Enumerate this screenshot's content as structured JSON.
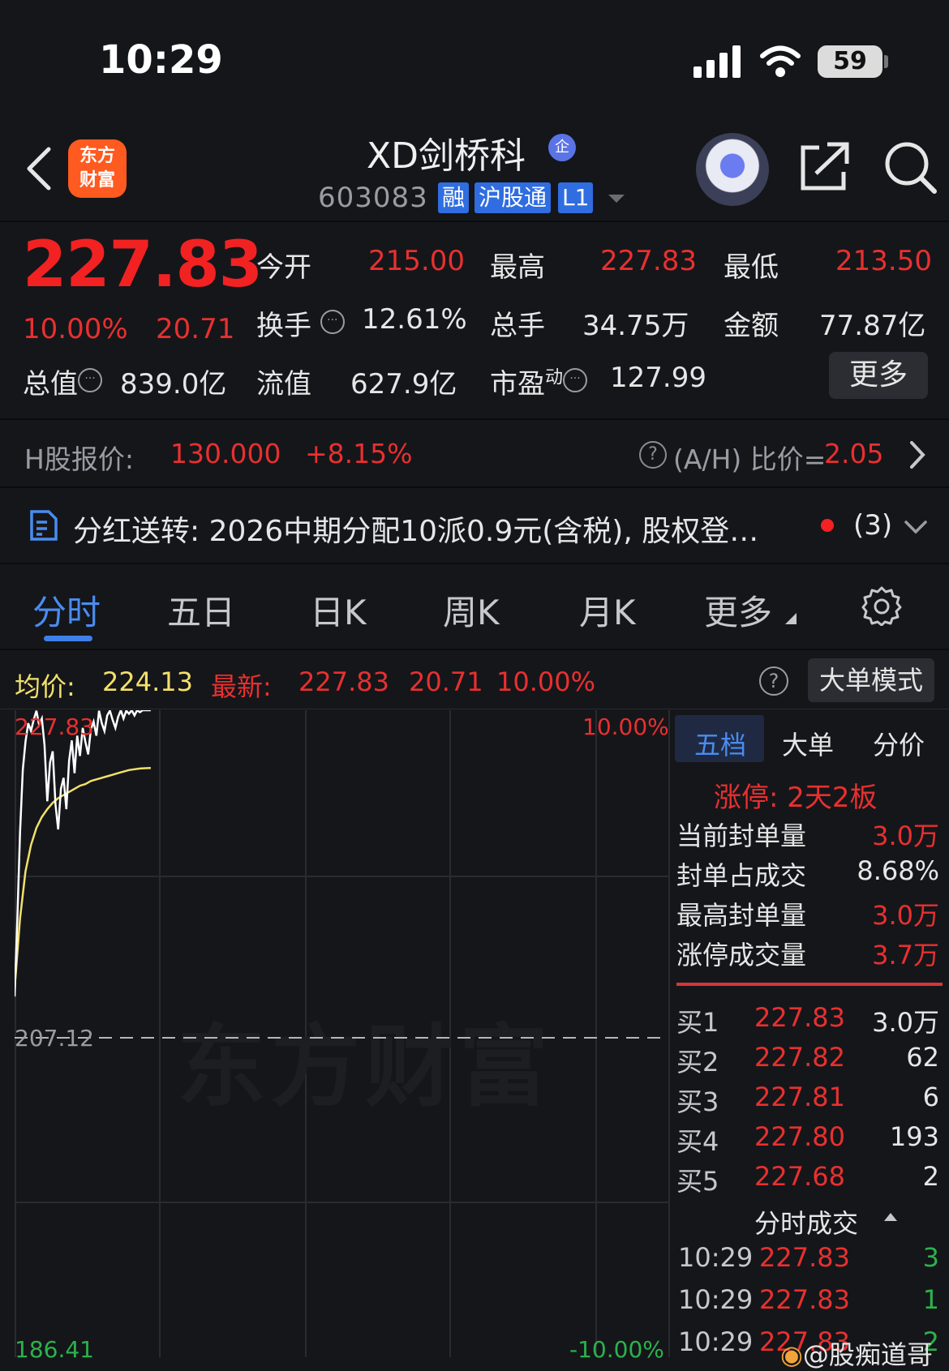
{
  "status_bar": {
    "time": "10:29",
    "battery": "59"
  },
  "header": {
    "logo_text": [
      "东方",
      "财富"
    ],
    "title": "XD剑桥科",
    "badge": "企",
    "code": "603083",
    "tags": [
      "融",
      "沪股通",
      "L1"
    ]
  },
  "quote": {
    "price": "227.83",
    "change_pct": "10.00%",
    "change": "20.71",
    "open_label": "今开",
    "open": "215.00",
    "high_label": "最高",
    "high": "227.83",
    "low_label": "最低",
    "low": "213.50",
    "turnover_label": "换手",
    "turnover": "12.61%",
    "volume_label": "总手",
    "volume": "34.75万",
    "amount_label": "金额",
    "amount": "77.87亿",
    "mktcap_label": "总值",
    "mktcap": "839.0亿",
    "float_label": "流值",
    "float": "627.9亿",
    "pe_label": "市盈",
    "pe_sup": "动",
    "pe": "127.99",
    "more": "更多"
  },
  "h_share": {
    "label": "H股报价:",
    "price": "130.000",
    "change": "+8.15%",
    "ratio_label": "(A/H) 比价=",
    "ratio": "2.05"
  },
  "dividend": {
    "text": "分红送转: 2026中期分配10派0.9元(含税), 股权登…",
    "count": "(3)"
  },
  "tabs": [
    "分时",
    "五日",
    "日K",
    "周K",
    "月K",
    "更多"
  ],
  "chart_header": {
    "avg_label": "均价:",
    "avg": "224.13",
    "latest_label": "最新:",
    "latest": "227.83",
    "latest_change": "20.71",
    "latest_pct": "10.00%",
    "mode_button": "大单模式"
  },
  "chart_data": {
    "type": "line",
    "y_top_label": "227.83",
    "y_mid_label": "207.12",
    "y_bottom_label": "186.41",
    "pct_top_label": "10.00%",
    "pct_bottom_label": "-10.00%",
    "ylim": [
      186.41,
      227.83
    ],
    "prev_close": 207.12,
    "series": [
      {
        "role": "price",
        "color": "#ffffff",
        "x": [
          0,
          1,
          2,
          3,
          4,
          5,
          6,
          7,
          8,
          9,
          10,
          11,
          12,
          13,
          14,
          15,
          16,
          17,
          18,
          19,
          20,
          21,
          22,
          23,
          24,
          25,
          26,
          27,
          28,
          29,
          30,
          31,
          32,
          33,
          34,
          35,
          36,
          37,
          38,
          39,
          40,
          41,
          42,
          43,
          44,
          45,
          46,
          47,
          48,
          49,
          50
        ],
        "values": [
          209.5,
          214.5,
          220.0,
          224.0,
          225.8,
          227.0,
          226.5,
          227.2,
          227.8,
          226.9,
          227.3,
          225.6,
          222.0,
          224.5,
          225.2,
          221.8,
          220.2,
          222.8,
          223.5,
          221.5,
          224.6,
          225.9,
          223.8,
          226.2,
          224.9,
          226.7,
          225.8,
          225.0,
          226.6,
          227.1,
          226.2,
          227.8,
          227.0,
          226.5,
          227.5,
          227.8,
          227.2,
          226.7,
          227.4,
          227.83,
          227.3,
          227.8,
          227.6,
          227.83,
          227.5,
          227.83,
          227.7,
          227.83,
          227.83,
          227.83,
          227.83
        ]
      },
      {
        "role": "average",
        "color": "#f2e06a",
        "x": [
          0,
          2,
          4,
          6,
          8,
          10,
          12,
          14,
          16,
          18,
          20,
          22,
          24,
          26,
          28,
          30,
          32,
          34,
          36,
          38,
          40,
          42,
          44,
          46,
          48,
          50
        ],
        "values": [
          210.0,
          214.5,
          217.5,
          219.2,
          220.3,
          221.0,
          221.5,
          221.9,
          222.2,
          222.4,
          222.6,
          222.8,
          223.0,
          223.1,
          223.3,
          223.4,
          223.5,
          223.6,
          223.7,
          223.8,
          223.9,
          224.0,
          224.05,
          224.1,
          224.12,
          224.13
        ]
      }
    ],
    "x_total": 240
  },
  "panel": {
    "subtabs": [
      "五档",
      "大单",
      "分价"
    ],
    "limit_label": "涨停: 2天2板",
    "stats": [
      {
        "label": "当前封单量",
        "value": "3.0万",
        "color": "#e8302f"
      },
      {
        "label": "封单占成交",
        "value": "8.68%",
        "color": "#e6e6e6"
      },
      {
        "label": "最高封单量",
        "value": "3.0万",
        "color": "#e8302f"
      },
      {
        "label": "涨停成交量",
        "value": "3.7万",
        "color": "#e8302f"
      }
    ],
    "bids": [
      {
        "label": "买1",
        "price": "227.83",
        "vol": "3.0万"
      },
      {
        "label": "买2",
        "price": "227.82",
        "vol": "62"
      },
      {
        "label": "买3",
        "price": "227.81",
        "vol": "6"
      },
      {
        "label": "买4",
        "price": "227.80",
        "vol": "193"
      },
      {
        "label": "买5",
        "price": "227.68",
        "vol": "2"
      }
    ],
    "ticks_title": "分时成交",
    "ticks": [
      {
        "time": "10:29",
        "price": "227.83",
        "vol": "3"
      },
      {
        "time": "10:29",
        "price": "227.83",
        "vol": "1"
      },
      {
        "time": "10:29",
        "price": "227.83",
        "vol": "2"
      }
    ]
  },
  "weibo_watermark": "@股痴道哥",
  "brand_watermark": "东方财富"
}
